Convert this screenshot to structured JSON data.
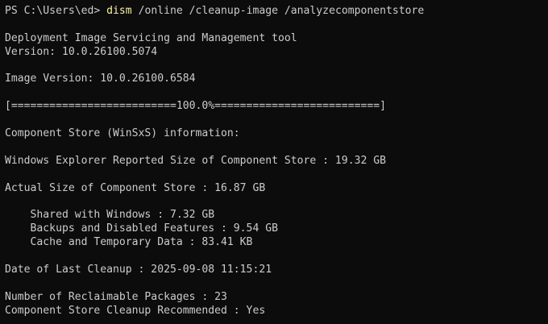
{
  "terminal": {
    "prompt": {
      "path": "PS C:\\Users\\ed> ",
      "command": "dism",
      "args": " /online /cleanup-image /analyzecomponentstore"
    },
    "output": {
      "tool_name": "Deployment Image Servicing and Management tool",
      "version": "Version: 10.0.26100.5074",
      "image_version": "Image Version: 10.0.26100.6584",
      "progress": "[==========================100.0%==========================]",
      "store_info": "Component Store (WinSxS) information:",
      "explorer_size": "Windows Explorer Reported Size of Component Store : 19.32 GB",
      "actual_size": "Actual Size of Component Store : 16.87 GB",
      "shared": "    Shared with Windows : 7.32 GB",
      "backups": "    Backups and Disabled Features : 9.54 GB",
      "cache": "    Cache and Temporary Data : 83.41 KB",
      "last_cleanup": "Date of Last Cleanup : 2025-09-08 11:15:21",
      "reclaimable": "Number of Reclaimable Packages : 23",
      "recommended": "Component Store Cleanup Recommended : Yes"
    },
    "colors": {
      "background": "#0c0c0c",
      "text": "#cccccc",
      "command": "#f9f1a5"
    }
  }
}
